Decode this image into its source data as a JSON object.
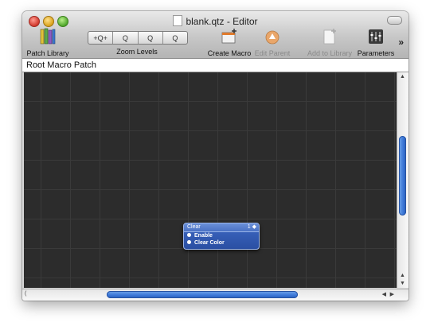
{
  "window": {
    "title": "blank.qtz - Editor"
  },
  "toolbar": {
    "patch_library": "Patch Library",
    "zoom_levels": "Zoom Levels",
    "zoom_buttons": [
      "+Q+",
      "Q",
      "Q",
      "Q"
    ],
    "create_macro": "Create Macro",
    "edit_parent": "Edit Parent",
    "add_to_library": "Add to Library",
    "parameters": "Parameters",
    "overflow": "»"
  },
  "pathbar": {
    "label": "Root Macro Patch"
  },
  "patch": {
    "title": "Clear",
    "menu": "1 ◆",
    "ports": [
      "Enable",
      "Clear Color"
    ]
  },
  "colors": {
    "canvas": "#2c2c2c",
    "patch": "#2a4fa3",
    "scroll_thumb": "#3b76d6"
  }
}
